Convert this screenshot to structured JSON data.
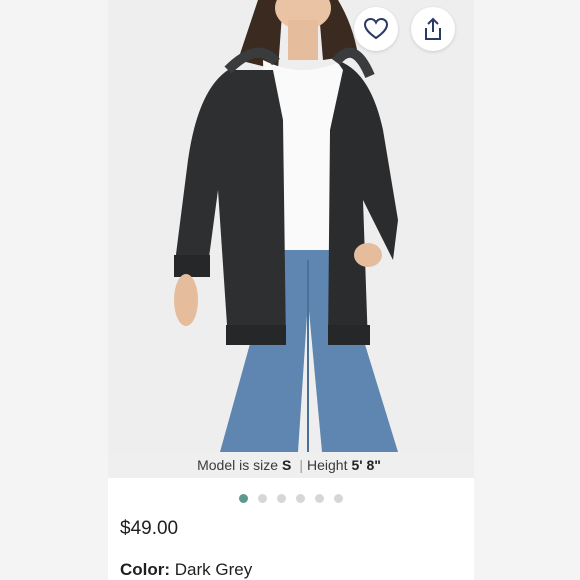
{
  "buttons": {
    "favorite_icon": "heart-icon",
    "share_icon": "share-icon"
  },
  "caption": {
    "model_prefix": "Model is size",
    "model_size": "S",
    "separator": "|",
    "height_label": "Height",
    "height_value": "5' 8\""
  },
  "carousel": {
    "total": 6,
    "active_index": 1,
    "accent": "#5b9a8b"
  },
  "product": {
    "price": "$49.00",
    "color_label": "Color:",
    "color_value": "Dark Grey"
  }
}
